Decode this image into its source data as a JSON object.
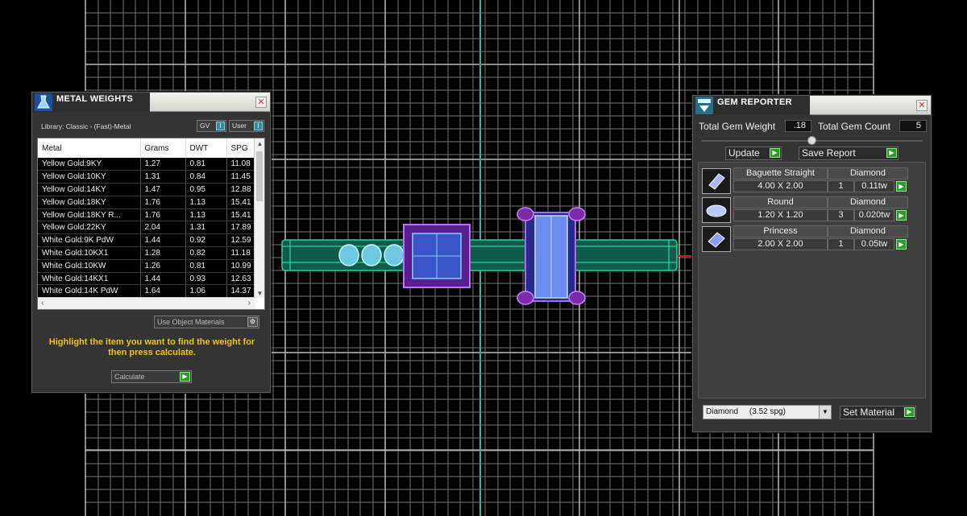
{
  "metal_weights": {
    "title": "METAL WEIGHTS",
    "library_label": "Library: Classic - (Fast)-Metal",
    "toggle_gv": "GV",
    "toggle_user": "User",
    "columns": [
      "Metal",
      "Grams",
      "DWT",
      "SPG"
    ],
    "rows": [
      [
        "Yellow Gold:9KY",
        "1.27",
        "0.81",
        "11.08"
      ],
      [
        "Yellow Gold:10KY",
        "1.31",
        "0.84",
        "11.45"
      ],
      [
        "Yellow Gold:14KY",
        "1.47",
        "0.95",
        "12.88"
      ],
      [
        "Yellow Gold:18KY",
        "1.76",
        "1.13",
        "15.41"
      ],
      [
        "Yellow Gold:18KY R...",
        "1.76",
        "1.13",
        "15.41"
      ],
      [
        "Yellow Gold:22KY",
        "2.04",
        "1.31",
        "17.89"
      ],
      [
        "White Gold:9K PdW",
        "1.44",
        "0.92",
        "12.59"
      ],
      [
        "White Gold:10KX1",
        "1.28",
        "0.82",
        "11.18"
      ],
      [
        "White Gold:10KW",
        "1.26",
        "0.81",
        "10.99"
      ],
      [
        "White Gold:14KX1",
        "1.44",
        "0.93",
        "12.63"
      ],
      [
        "White Gold:14K PdW",
        "1.64",
        "1.06",
        "14.37"
      ]
    ],
    "use_object_materials": "Use Object Materials",
    "hint": "Highlight the item you want to find the weight for then press calculate.",
    "calculate": "Calculate"
  },
  "gem_reporter": {
    "title": "GEM REPORTER",
    "total_weight_label": "Total Gem Weight",
    "total_weight_value": ".18",
    "total_count_label": "Total Gem Count",
    "total_count_value": "5",
    "update": "Update",
    "save_report": "Save Report",
    "gems": [
      {
        "shape": "Baguette Straight",
        "size": "4.00 X 2.00",
        "material": "Diamond",
        "count": "1",
        "weight": "0.11tw"
      },
      {
        "shape": "Round",
        "size": "1.20 X 1.20",
        "material": "Diamond",
        "count": "3",
        "weight": "0.020tw"
      },
      {
        "shape": "Princess",
        "size": "2.00 X 2.00",
        "material": "Diamond",
        "count": "1",
        "weight": "0.05tw"
      }
    ],
    "material_select": "Diamond     (3.52 spg)",
    "set_material": "Set Material"
  }
}
